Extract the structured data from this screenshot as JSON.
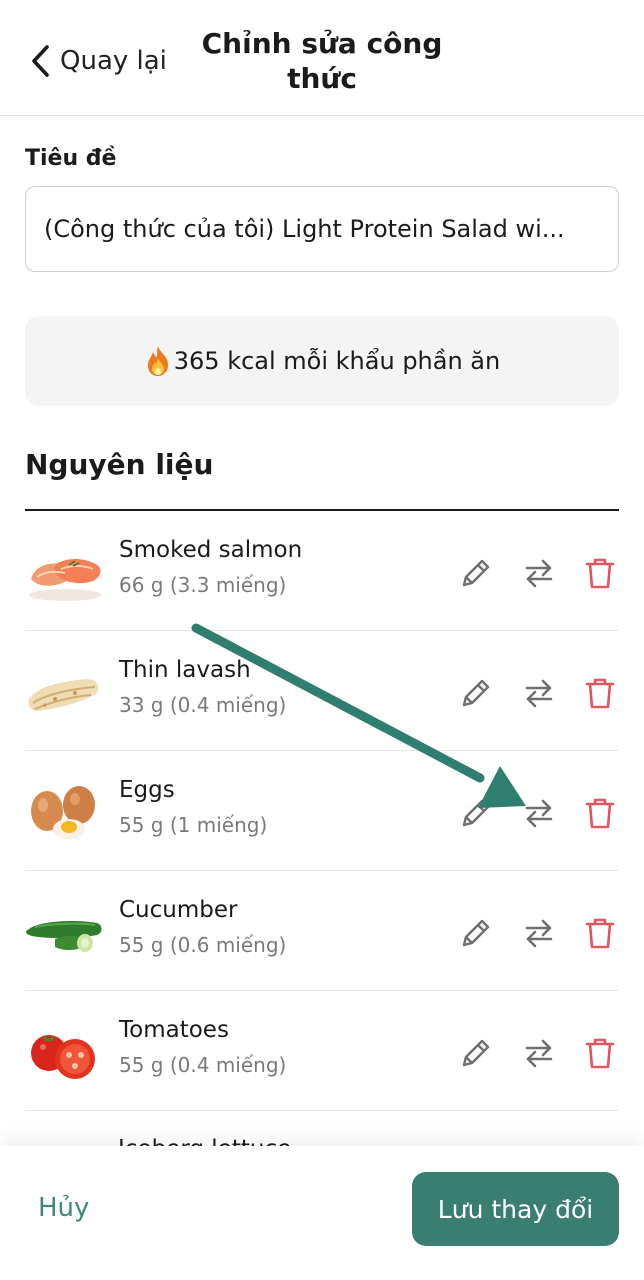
{
  "header": {
    "back_label": "Quay lại",
    "title_line1": "Chỉnh sửa công",
    "title_line2": "thức"
  },
  "form": {
    "title_label": "Tiêu đề",
    "title_value": "(Công thức của tôi) Light Protein Salad wi..."
  },
  "kcal": {
    "text": "365 kcal mỗi khẩu phần ăn",
    "icon": "fire-emoji"
  },
  "ingredients": {
    "heading": "Nguyên liệu",
    "items": [
      {
        "name": "Smoked salmon",
        "amount": "66 g (3.3 miếng)"
      },
      {
        "name": "Thin lavash",
        "amount": "33 g (0.4 miếng)"
      },
      {
        "name": "Eggs",
        "amount": "55 g (1 miếng)"
      },
      {
        "name": "Cucumber",
        "amount": "55 g (0.6 miếng)"
      },
      {
        "name": "Tomatoes",
        "amount": "55 g (0.4 miếng)"
      },
      {
        "name": "Iceberg lettuce"
      }
    ]
  },
  "footer": {
    "cancel_label": "Hủy",
    "save_label": "Lưu thay đổi"
  },
  "colors": {
    "accent": "#3a7e72",
    "accent_text": "#3d8a7d",
    "delete": "#e0555f",
    "icon_gray": "#6f6f6f",
    "annotation_arrow": "#2f7e6f"
  }
}
